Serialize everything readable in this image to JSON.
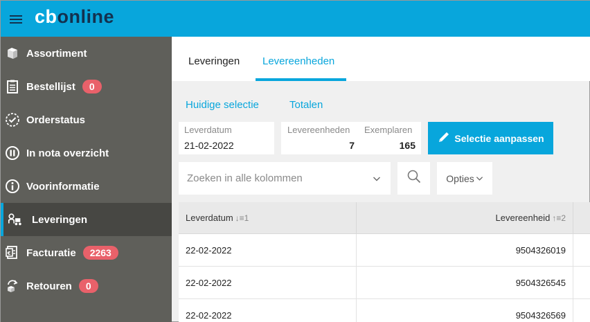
{
  "header": {
    "logo_cb": "cb",
    "logo_online": "online",
    "brand_color": "#08a6dc",
    "logo_dark": "#13314f"
  },
  "sidebar": {
    "items": [
      {
        "label": "Assortiment",
        "icon": "book-icon"
      },
      {
        "label": "Bestellijst",
        "icon": "clipboard-icon",
        "badge": "0"
      },
      {
        "label": "Orderstatus",
        "icon": "check-circle-icon"
      },
      {
        "label": "In nota overzicht",
        "icon": "pause-circle-icon"
      },
      {
        "label": "Voorinformatie",
        "icon": "info-circle-icon"
      },
      {
        "label": "Leveringen",
        "icon": "delivery-icon",
        "active": true
      },
      {
        "label": "Facturatie",
        "icon": "invoice-icon",
        "badge": "2263"
      },
      {
        "label": "Retouren",
        "icon": "return-icon",
        "badge": "0"
      }
    ]
  },
  "tabs": [
    {
      "label": "Leveringen",
      "active": false
    },
    {
      "label": "Levereenheden",
      "active": true
    }
  ],
  "subnav": {
    "current": "Huidige selectie",
    "totals": "Totalen"
  },
  "selection": {
    "leverdatum_label": "Leverdatum",
    "leverdatum_value": "21-02-2022",
    "levereenheden_label": "Levereenheden",
    "levereenheden_value": "7",
    "exemplaren_label": "Exemplaren",
    "exemplaren_value": "165",
    "edit_button": "Selectie aanpassen"
  },
  "search": {
    "placeholder": "Zoeken in alle kolommen",
    "options_label": "Opties"
  },
  "table": {
    "columns": [
      {
        "label": "Leverdatum",
        "sort": "↓≡1"
      },
      {
        "label": "Levereenheid",
        "sort": "↑≡2"
      }
    ],
    "rows": [
      {
        "leverdatum": "22-02-2022",
        "levereenheid": "9504326019"
      },
      {
        "leverdatum": "22-02-2022",
        "levereenheid": "9504326545"
      },
      {
        "leverdatum": "22-02-2022",
        "levereenheid": "9504326569"
      }
    ]
  }
}
